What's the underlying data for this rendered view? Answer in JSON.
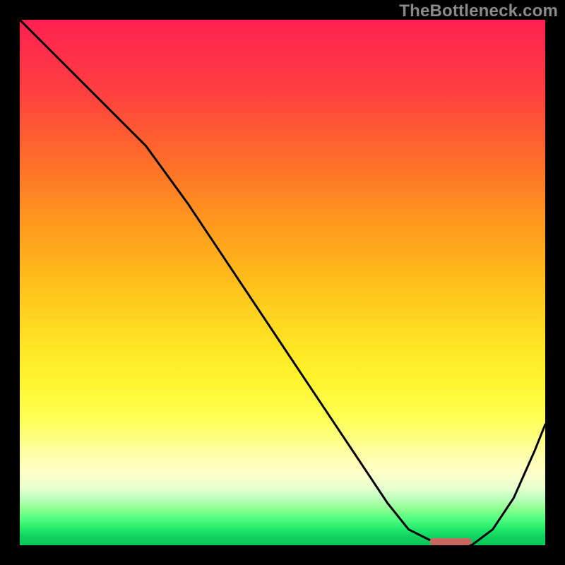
{
  "watermark": "TheBottleneck.com",
  "chart_data": {
    "type": "line",
    "title": "",
    "xlabel": "",
    "ylabel": "",
    "xlim": [
      0,
      100
    ],
    "ylim": [
      0,
      100
    ],
    "gradient_colors": {
      "top": "#ff2050",
      "mid_upper": "#ff8f1f",
      "mid": "#ffff55",
      "mid_lower": "#c0ffc0",
      "bottom": "#0ac858"
    },
    "series": [
      {
        "name": "bottleneck-curve",
        "x": [
          0,
          8,
          16,
          24,
          32,
          40,
          48,
          56,
          64,
          70,
          74,
          78,
          82,
          86,
          90,
          94,
          98,
          100
        ],
        "y": [
          100,
          92,
          84,
          76,
          65,
          53,
          41,
          29,
          17,
          8,
          3,
          1,
          0,
          0,
          3,
          9,
          18,
          23
        ]
      }
    ],
    "best_range_marker": {
      "x_start": 78,
      "x_end": 86,
      "y": 0,
      "color": "#c86860"
    }
  }
}
